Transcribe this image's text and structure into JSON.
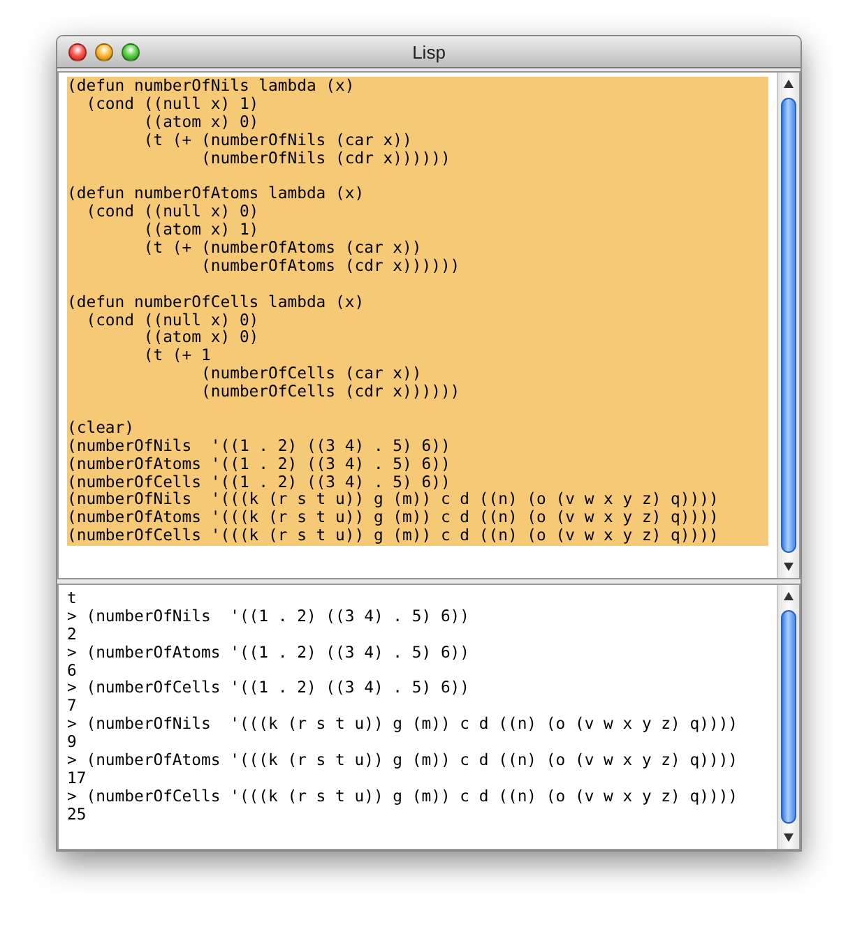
{
  "window": {
    "title": "Lisp"
  },
  "editor": {
    "selected": true,
    "blocks": [
      [
        "(defun numberOfNils lambda (x)",
        "  (cond ((null x) 1)",
        "        ((atom x) 0)",
        "        (t (+ (numberOfNils (car x))",
        "              (numberOfNils (cdr x))))))"
      ],
      [
        "(defun numberOfAtoms lambda (x)",
        "  (cond ((null x) 0)",
        "        ((atom x) 1)",
        "        (t (+ (numberOfAtoms (car x))",
        "              (numberOfAtoms (cdr x))))))"
      ],
      [
        "(defun numberOfCells lambda (x)",
        "  (cond ((null x) 0)",
        "        ((atom x) 0)",
        "        (t (+ 1",
        "              (numberOfCells (car x))",
        "              (numberOfCells (cdr x))))))"
      ],
      [
        "(clear)",
        "(numberOfNils  '((1 . 2) ((3 4) . 5) 6))",
        "(numberOfAtoms '((1 . 2) ((3 4) . 5) 6))",
        "(numberOfCells '((1 . 2) ((3 4) . 5) 6))",
        "(numberOfNils  '(((k (r s t u)) g (m)) c d ((n) (o (v w x y z) q))))",
        "(numberOfAtoms '(((k (r s t u)) g (m)) c d ((n) (o (v w x y z) q))))",
        "(numberOfCells '(((k (r s t u)) g (m)) c d ((n) (o (v w x y z) q))))"
      ]
    ]
  },
  "output": {
    "lines": [
      "t",
      "> (numberOfNils  '((1 . 2) ((3 4) . 5) 6))",
      "2",
      "> (numberOfAtoms '((1 . 2) ((3 4) . 5) 6))",
      "6",
      "> (numberOfCells '((1 . 2) ((3 4) . 5) 6))",
      "7",
      "> (numberOfNils  '(((k (r s t u)) g (m)) c d ((n) (o (v w x y z) q))))",
      "9",
      "> (numberOfAtoms '(((k (r s t u)) g (m)) c d ((n) (o (v w x y z) q))))",
      "17",
      "> (numberOfCells '(((k (r s t u)) g (m)) c d ((n) (o (v w x y z) q))))",
      "25"
    ]
  }
}
